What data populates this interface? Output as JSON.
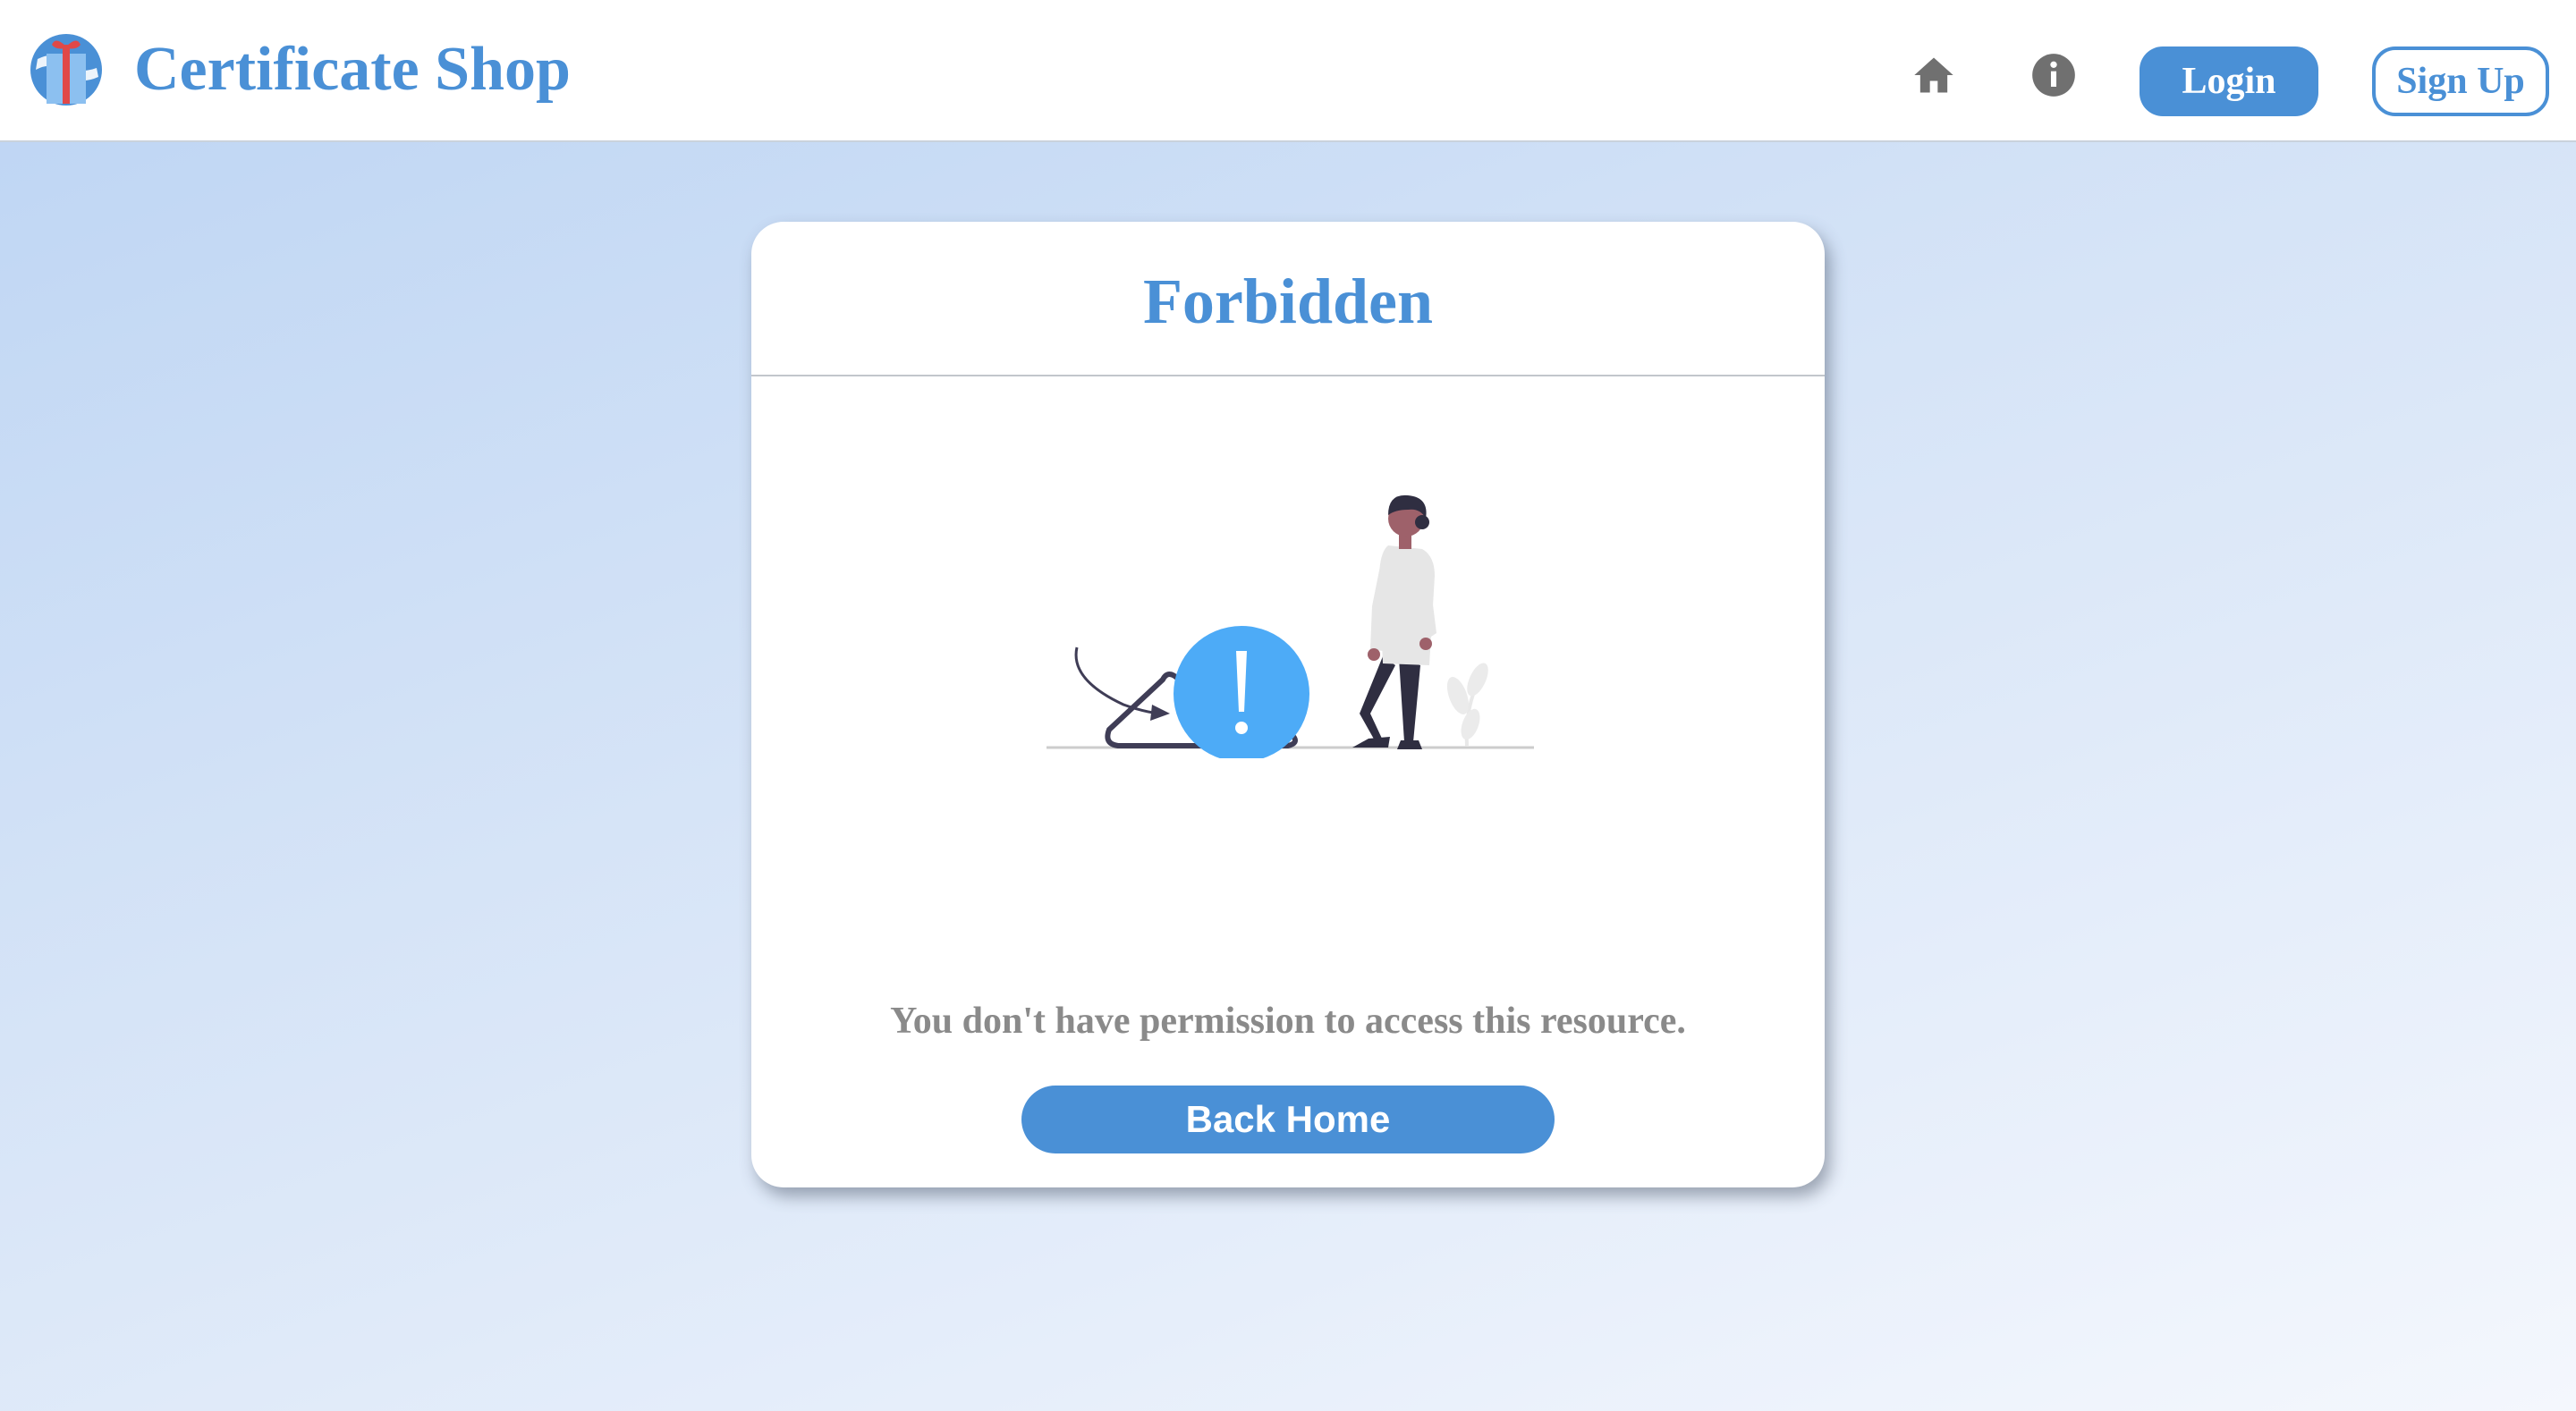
{
  "header": {
    "brand_title": "Certificate Shop",
    "logo_icon": "gift-globe-logo-icon",
    "nav_icons": [
      "home-icon",
      "info-icon"
    ],
    "login_label": "Login",
    "signup_label": "Sign Up"
  },
  "card": {
    "title": "Forbidden",
    "illustration": "person-warning-illustration",
    "message": "You don't have permission to access this resource.",
    "back_label": "Back Home"
  },
  "colors": {
    "accent": "#4a90d6",
    "warning_circle": "#4dabf7",
    "muted_text": "#8a8a8a",
    "card_background": "#ffffff"
  }
}
